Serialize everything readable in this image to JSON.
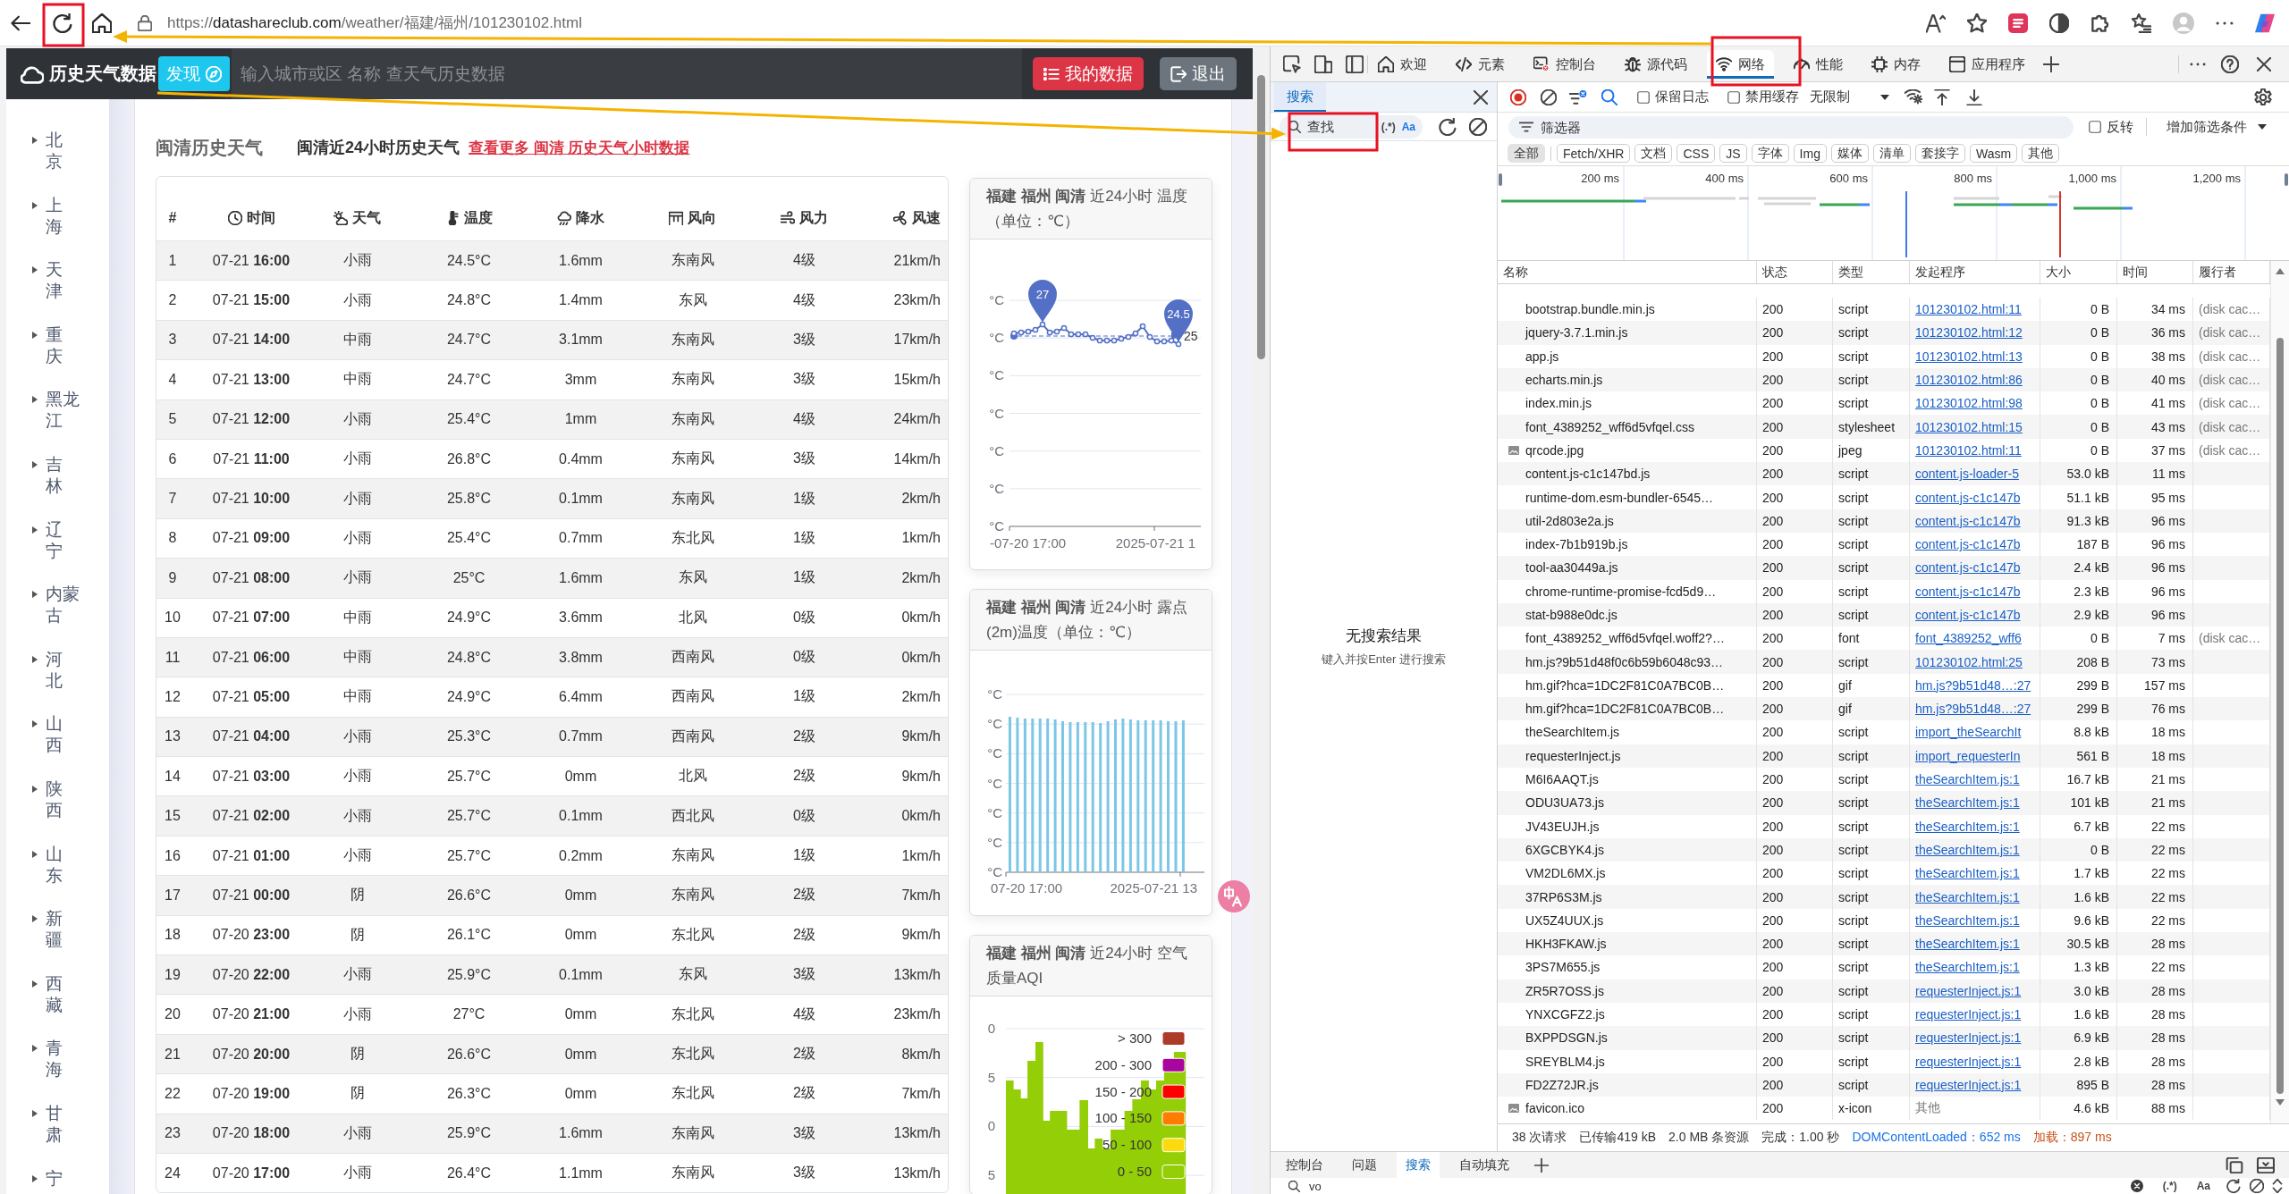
{
  "browser": {
    "url_scheme": "https://",
    "url_host": "datashareclub.com",
    "url_path": "/weather/福建/福州/101230102.html"
  },
  "site_header": {
    "brand": "历史天气数据",
    "discover": "发现",
    "search": {
      "placeholder": "输入城市或区 名称 查天气历史数据"
    },
    "buttons": [
      {
        "label": "我的数据",
        "kind": "primary"
      },
      {
        "label": "退出",
        "kind": "secondary"
      }
    ]
  },
  "sidebar": {
    "items": [
      {
        "label": "北京"
      },
      {
        "label": "上海"
      },
      {
        "label": "天津"
      },
      {
        "label": "重庆"
      },
      {
        "label": "黑龙江"
      },
      {
        "label": "吉林"
      },
      {
        "label": "辽宁"
      },
      {
        "label": "内蒙古"
      },
      {
        "label": "河北"
      },
      {
        "label": "山西"
      },
      {
        "label": "陕西"
      },
      {
        "label": "山东"
      },
      {
        "label": "新疆"
      },
      {
        "label": "西藏"
      },
      {
        "label": "青海"
      },
      {
        "label": "甘肃"
      },
      {
        "label": "宁"
      }
    ]
  },
  "main": {
    "title": "闽清历史天气",
    "subtitle": "闽清近24小时历史天气",
    "more_link": "查看更多 闽清 历史天气小时数据",
    "table": {
      "columns": [
        "#",
        "时间",
        "天气",
        "温度",
        "降水",
        "风向",
        "风力",
        "风速"
      ],
      "rows": [
        [
          "1",
          "07-21 **16:00**",
          "小雨",
          "24.5°C",
          "1.6mm",
          "东南风",
          "4级",
          "21km/h"
        ],
        [
          "2",
          "07-21 **15:00**",
          "小雨",
          "24.8°C",
          "1.4mm",
          "东风",
          "4级",
          "23km/h"
        ],
        [
          "3",
          "07-21 **14:00**",
          "中雨",
          "24.7°C",
          "3.1mm",
          "东南风",
          "3级",
          "17km/h"
        ],
        [
          "4",
          "07-21 **13:00**",
          "中雨",
          "24.7°C",
          "3mm",
          "东南风",
          "3级",
          "15km/h"
        ],
        [
          "5",
          "07-21 **12:00**",
          "小雨",
          "25.4°C",
          "1mm",
          "东南风",
          "4级",
          "24km/h"
        ],
        [
          "6",
          "07-21 **11:00**",
          "小雨",
          "26.8°C",
          "0.4mm",
          "东南风",
          "3级",
          "14km/h"
        ],
        [
          "7",
          "07-21 **10:00**",
          "小雨",
          "25.8°C",
          "0.1mm",
          "东南风",
          "1级",
          "2km/h"
        ],
        [
          "8",
          "07-21 **09:00**",
          "小雨",
          "25.4°C",
          "0.7mm",
          "东北风",
          "1级",
          "1km/h"
        ],
        [
          "9",
          "07-21 **08:00**",
          "小雨",
          "25°C",
          "1.6mm",
          "东风",
          "1级",
          "2km/h"
        ],
        [
          "10",
          "07-21 **07:00**",
          "中雨",
          "24.9°C",
          "3.6mm",
          "北风",
          "0级",
          "0km/h"
        ],
        [
          "11",
          "07-21 **06:00**",
          "中雨",
          "24.8°C",
          "3.8mm",
          "西南风",
          "0级",
          "0km/h"
        ],
        [
          "12",
          "07-21 **05:00**",
          "中雨",
          "24.9°C",
          "6.4mm",
          "西南风",
          "1级",
          "2km/h"
        ],
        [
          "13",
          "07-21 **04:00**",
          "小雨",
          "25.3°C",
          "0.7mm",
          "西南风",
          "2级",
          "9km/h"
        ],
        [
          "14",
          "07-21 **03:00**",
          "小雨",
          "25.7°C",
          "0mm",
          "北风",
          "2级",
          "9km/h"
        ],
        [
          "15",
          "07-21 **02:00**",
          "小雨",
          "25.7°C",
          "0.1mm",
          "西北风",
          "0级",
          "0km/h"
        ],
        [
          "16",
          "07-21 **01:00**",
          "小雨",
          "25.7°C",
          "0.2mm",
          "东南风",
          "1级",
          "1km/h"
        ],
        [
          "17",
          "07-21 **00:00**",
          "阴",
          "26.6°C",
          "0mm",
          "东南风",
          "2级",
          "7km/h"
        ],
        [
          "18",
          "07-20 **23:00**",
          "阴",
          "26.1°C",
          "0mm",
          "东北风",
          "2级",
          "9km/h"
        ],
        [
          "19",
          "07-20 **22:00**",
          "小雨",
          "25.9°C",
          "0.1mm",
          "东风",
          "3级",
          "13km/h"
        ],
        [
          "20",
          "07-20 **21:00**",
          "小雨",
          "27°C",
          "0mm",
          "东北风",
          "4级",
          "23km/h"
        ],
        [
          "21",
          "07-20 **20:00**",
          "阴",
          "26.6°C",
          "0mm",
          "东北风",
          "2级",
          "8km/h"
        ],
        [
          "22",
          "07-20 **19:00**",
          "阴",
          "26.3°C",
          "0mm",
          "东北风",
          "2级",
          "7km/h"
        ],
        [
          "23",
          "07-20 **18:00**",
          "小雨",
          "25.9°C",
          "1.6mm",
          "东南风",
          "3级",
          "13km/h"
        ],
        [
          "24",
          "07-20 **17:00**",
          "小雨",
          "26.4°C",
          "1.1mm",
          "东南风",
          "3级",
          "13km/h"
        ]
      ]
    }
  },
  "charts": [
    {
      "kind": "line",
      "title": "**福建 福州 闽清** 近24小时 温度（单位：℃）",
      "y_labels": [
        "°C",
        "°C",
        "°C",
        "°C",
        "°C",
        "°C",
        "°C"
      ],
      "x_labels": [
        "-07-20 17:00",
        "2025-07-21 1"
      ],
      "markers": [
        "27",
        "24.5"
      ],
      "average_label": "25"
    },
    {
      "kind": "bar",
      "title": "**福建 福州 闽清** 近24小时 露点(2m)温度（单位：℃）",
      "y_labels": [
        "°C",
        "°C",
        "°C",
        "°C",
        "°C",
        "°C",
        "°C"
      ],
      "x_labels": [
        "07-20 17:00",
        "2025-07-21 13"
      ]
    },
    {
      "kind": "area",
      "title": "**福建 福州 闽清** 近24小时 空气质量AQI",
      "y_labels": [
        "0",
        "5",
        "0",
        "5"
      ],
      "legend": [
        {
          "label": "> 300",
          "color": "#ac3b2a"
        },
        {
          "label": "200 - 300",
          "color": "#aa069f"
        },
        {
          "label": "150 - 200",
          "color": "#fd0100"
        },
        {
          "label": "100 - 150",
          "color": "#fc7d02"
        },
        {
          "label": "50 - 100",
          "color": "#fbdb0f"
        },
        {
          "label": "0 - 50",
          "color": "#93ce07"
        }
      ]
    }
  ],
  "devtools": {
    "tabs": [
      {
        "label": "欢迎",
        "selected": false
      },
      {
        "label": "元素",
        "selected": false
      },
      {
        "label": "控制台",
        "selected": false
      },
      {
        "label": "源代码",
        "selected": false
      },
      {
        "label": "网络",
        "selected": true
      },
      {
        "label": "性能",
        "selected": false
      },
      {
        "label": "内存",
        "selected": false
      },
      {
        "label": "应用程序",
        "selected": false
      }
    ],
    "search_panel": {
      "tab": {
        "label": "搜索",
        "selected": true
      },
      "search": {
        "placeholder": "查找"
      },
      "regex_toggle": "(.*)",
      "case_toggle": "Aa",
      "empty_title": "无搜索结果",
      "empty_hint": "键入并按Enter 进行搜索"
    },
    "network": {
      "toolbar": {
        "recording": true,
        "checkboxes": [
          {
            "label": "保留日志",
            "checked": false
          },
          {
            "label": "禁用缓存",
            "checked": false
          }
        ],
        "throttling": "无限制"
      },
      "filter": {
        "placeholder": "筛选器",
        "invert": {
          "label": "反转",
          "checked": false
        },
        "more_filters": "增加筛选条件"
      },
      "types": [
        {
          "label": "全部",
          "selected": true
        },
        {
          "label": "Fetch/XHR",
          "selected": false
        },
        {
          "label": "文档",
          "selected": false
        },
        {
          "label": "CSS",
          "selected": false
        },
        {
          "label": "JS",
          "selected": false
        },
        {
          "label": "字体",
          "selected": false
        },
        {
          "label": "Img",
          "selected": false
        },
        {
          "label": "媒体",
          "selected": false
        },
        {
          "label": "清单",
          "selected": false
        },
        {
          "label": "套接字",
          "selected": false
        },
        {
          "label": "Wasm",
          "selected": false
        },
        {
          "label": "其他",
          "selected": false
        }
      ],
      "overview": {
        "ticks": [
          "200 ms",
          "400 ms",
          "600 ms",
          "800 ms",
          "1,000 ms",
          "1,200 ms"
        ]
      },
      "columns": [
        "名称",
        "状态",
        "类型",
        "发起程序",
        "大小",
        "时间",
        "履行者"
      ],
      "rows": [
        {
          "name": "bootstrap.bundle.min.js",
          "kind": "plain",
          "status": "200",
          "type": "script",
          "initiator": "101230102.html:11",
          "link": true,
          "size": "0 B",
          "time": "34 ms",
          "fulfilled": "(disk cac…"
        },
        {
          "name": "jquery-3.7.1.min.js",
          "kind": "plain",
          "status": "200",
          "type": "script",
          "initiator": "101230102.html:12",
          "link": true,
          "size": "0 B",
          "time": "36 ms",
          "fulfilled": "(disk cac…"
        },
        {
          "name": "app.js",
          "kind": "plain",
          "status": "200",
          "type": "script",
          "initiator": "101230102.html:13",
          "link": true,
          "size": "0 B",
          "time": "38 ms",
          "fulfilled": "(disk cac…"
        },
        {
          "name": "echarts.min.js",
          "kind": "plain",
          "status": "200",
          "type": "script",
          "initiator": "101230102.html:86",
          "link": true,
          "size": "0 B",
          "time": "40 ms",
          "fulfilled": "(disk cac…"
        },
        {
          "name": "index.min.js",
          "kind": "plain",
          "status": "200",
          "type": "script",
          "initiator": "101230102.html:98",
          "link": true,
          "size": "0 B",
          "time": "41 ms",
          "fulfilled": "(disk cac…"
        },
        {
          "name": "font_4389252_wff6d5vfqel.css",
          "kind": "plain",
          "status": "200",
          "type": "stylesheet",
          "initiator": "101230102.html:15",
          "link": true,
          "size": "0 B",
          "time": "43 ms",
          "fulfilled": "(disk cac…"
        },
        {
          "name": "qrcode.jpg",
          "kind": "image",
          "status": "200",
          "type": "jpeg",
          "initiator": "101230102.html:11",
          "link": true,
          "size": "0 B",
          "time": "37 ms",
          "fulfilled": "(disk cac…"
        },
        {
          "name": "content.js-c1c147bd.js",
          "kind": "plain",
          "status": "200",
          "type": "script",
          "initiator": "content.js-loader-5",
          "link": true,
          "size": "53.0 kB",
          "time": "11 ms"
        },
        {
          "name": "runtime-dom.esm-bundler-6545…",
          "kind": "plain",
          "status": "200",
          "type": "script",
          "initiator": "content.js-c1c147b",
          "link": true,
          "size": "51.1 kB",
          "time": "95 ms"
        },
        {
          "name": "util-2d803e2a.js",
          "kind": "plain",
          "status": "200",
          "type": "script",
          "initiator": "content.js-c1c147b",
          "link": true,
          "size": "91.3 kB",
          "time": "96 ms"
        },
        {
          "name": "index-7b1b919b.js",
          "kind": "plain",
          "status": "200",
          "type": "script",
          "initiator": "content.js-c1c147b",
          "link": true,
          "size": "187 B",
          "time": "96 ms"
        },
        {
          "name": "tool-aa30449a.js",
          "kind": "plain",
          "status": "200",
          "type": "script",
          "initiator": "content.js-c1c147b",
          "link": true,
          "size": "2.4 kB",
          "time": "96 ms"
        },
        {
          "name": "chrome-runtime-promise-fcd5d9…",
          "kind": "plain",
          "status": "200",
          "type": "script",
          "initiator": "content.js-c1c147b",
          "link": true,
          "size": "2.3 kB",
          "time": "96 ms"
        },
        {
          "name": "stat-b988e0dc.js",
          "kind": "plain",
          "status": "200",
          "type": "script",
          "initiator": "content.js-c1c147b",
          "link": true,
          "size": "2.9 kB",
          "time": "96 ms"
        },
        {
          "name": "font_4389252_wff6d5vfqel.woff2?…",
          "kind": "plain",
          "status": "200",
          "type": "font",
          "initiator": "font_4389252_wff6",
          "link": true,
          "size": "0 B",
          "time": "7 ms",
          "fulfilled": "(disk cac…"
        },
        {
          "name": "hm.js?9b51d48f0c6b59b6048c93…",
          "kind": "plain",
          "status": "200",
          "type": "script",
          "initiator": "101230102.html:25",
          "link": true,
          "size": "208 B",
          "time": "73 ms"
        },
        {
          "name": "hm.gif?hca=1DC2F81C0A7BC0B…",
          "kind": "plain",
          "status": "200",
          "type": "gif",
          "initiator": "hm.js?9b51d48…:27",
          "link": true,
          "size": "299 B",
          "time": "157 ms"
        },
        {
          "name": "hm.gif?hca=1DC2F81C0A7BC0B…",
          "kind": "plain",
          "status": "200",
          "type": "gif",
          "initiator": "hm.js?9b51d48…:27",
          "link": true,
          "size": "299 B",
          "time": "76 ms"
        },
        {
          "name": "theSearchItem.js",
          "kind": "plain",
          "status": "200",
          "type": "script",
          "initiator": "import_theSearchIt",
          "link": true,
          "size": "8.8 kB",
          "time": "18 ms"
        },
        {
          "name": "requesterInject.js",
          "kind": "plain",
          "status": "200",
          "type": "script",
          "initiator": "import_requesterIn",
          "link": true,
          "size": "561 B",
          "time": "18 ms"
        },
        {
          "name": "M6I6AAQT.js",
          "kind": "plain",
          "status": "200",
          "type": "script",
          "initiator": "theSearchItem.js:1",
          "link": true,
          "size": "16.7 kB",
          "time": "21 ms"
        },
        {
          "name": "ODU3UA73.js",
          "kind": "plain",
          "status": "200",
          "type": "script",
          "initiator": "theSearchItem.js:1",
          "link": true,
          "size": "101 kB",
          "time": "21 ms"
        },
        {
          "name": "JV43EUJH.js",
          "kind": "plain",
          "status": "200",
          "type": "script",
          "initiator": "theSearchItem.js:1",
          "link": true,
          "size": "6.7 kB",
          "time": "22 ms"
        },
        {
          "name": "6XGCBYK4.js",
          "kind": "plain",
          "status": "200",
          "type": "script",
          "initiator": "theSearchItem.js:1",
          "link": true,
          "size": "0 B",
          "time": "22 ms"
        },
        {
          "name": "VM2DL6MX.js",
          "kind": "plain",
          "status": "200",
          "type": "script",
          "initiator": "theSearchItem.js:1",
          "link": true,
          "size": "1.7 kB",
          "time": "22 ms"
        },
        {
          "name": "37RP6S3M.js",
          "kind": "plain",
          "status": "200",
          "type": "script",
          "initiator": "theSearchItem.js:1",
          "link": true,
          "size": "1.6 kB",
          "time": "22 ms"
        },
        {
          "name": "UX5Z4UUX.js",
          "kind": "plain",
          "status": "200",
          "type": "script",
          "initiator": "theSearchItem.js:1",
          "link": true,
          "size": "9.6 kB",
          "time": "22 ms"
        },
        {
          "name": "HKH3FKAW.js",
          "kind": "plain",
          "status": "200",
          "type": "script",
          "initiator": "theSearchItem.js:1",
          "link": true,
          "size": "30.5 kB",
          "time": "28 ms"
        },
        {
          "name": "3PS7M655.js",
          "kind": "plain",
          "status": "200",
          "type": "script",
          "initiator": "theSearchItem.js:1",
          "link": true,
          "size": "1.3 kB",
          "time": "22 ms"
        },
        {
          "name": "ZR5R7OSS.js",
          "kind": "plain",
          "status": "200",
          "type": "script",
          "initiator": "requesterInject.js:1",
          "link": true,
          "size": "3.0 kB",
          "time": "28 ms"
        },
        {
          "name": "YNXCGFZ2.js",
          "kind": "plain",
          "status": "200",
          "type": "script",
          "initiator": "requesterInject.js:1",
          "link": true,
          "size": "1.6 kB",
          "time": "28 ms"
        },
        {
          "name": "BXPPDSGN.js",
          "kind": "plain",
          "status": "200",
          "type": "script",
          "initiator": "requesterInject.js:1",
          "link": true,
          "size": "6.9 kB",
          "time": "28 ms"
        },
        {
          "name": "SREYBLM4.js",
          "kind": "plain",
          "status": "200",
          "type": "script",
          "initiator": "requesterInject.js:1",
          "link": true,
          "size": "2.8 kB",
          "time": "28 ms"
        },
        {
          "name": "FD2Z72JR.js",
          "kind": "plain",
          "status": "200",
          "type": "script",
          "initiator": "requesterInject.js:1",
          "link": true,
          "size": "895 B",
          "time": "28 ms"
        },
        {
          "name": "favicon.ico",
          "kind": "image",
          "status": "200",
          "type": "x-icon",
          "initiator": "其他",
          "link": false,
          "size": "4.6 kB",
          "time": "88 ms"
        }
      ],
      "summary": [
        {
          "text": "38 次请求",
          "kind": "plain"
        },
        {
          "text": "已传输419 kB",
          "kind": "plain"
        },
        {
          "text": "2.0 MB 条资源",
          "kind": "plain"
        },
        {
          "text": "完成：1.00 秒",
          "kind": "plain"
        },
        {
          "text": "DOMContentLoaded：652 ms",
          "kind": "dom"
        },
        {
          "text": "加载：897 ms",
          "kind": "load"
        }
      ]
    },
    "drawer": {
      "tabs": [
        {
          "label": "控制台",
          "selected": false
        },
        {
          "label": "问题",
          "selected": false
        },
        {
          "label": "搜索",
          "selected": true
        },
        {
          "label": "自动填充",
          "selected": false
        }
      ],
      "search": {
        "value": "vo"
      },
      "regex_toggle": "(.*)",
      "case_toggle": "Aa"
    }
  }
}
